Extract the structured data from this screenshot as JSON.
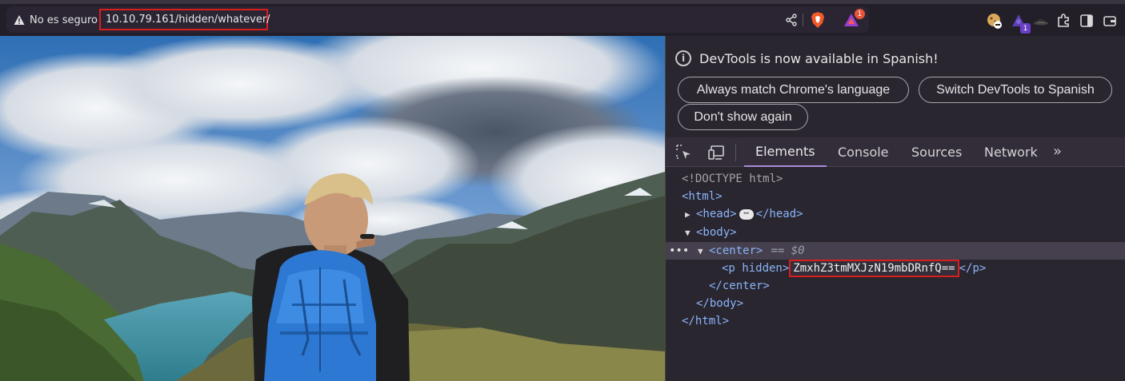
{
  "browser": {
    "security_label": "No es seguro",
    "url": "10.10.79.161/hidden/whatever/",
    "bat_badge": "1",
    "extension_badge": "1"
  },
  "devtools": {
    "info_message": "DevTools is now available in Spanish!",
    "buttons": {
      "always_match": "Always match Chrome's language",
      "switch_spanish": "Switch DevTools to Spanish",
      "dont_show": "Don't show again"
    },
    "tabs": [
      "Elements",
      "Console",
      "Sources",
      "Network"
    ],
    "dom": {
      "doctype": "<!DOCTYPE html>",
      "html_open": "<html>",
      "head_open": "<head>",
      "head_close": "</head>",
      "body_open": "<body>",
      "center_open": "<center>",
      "center_note": "== $0",
      "p_open": "<p hidden>",
      "p_text": "ZmxhZ3tmMXJzN19mbDRnfQ==",
      "p_close": "</p>",
      "center_close": "</center>",
      "body_close": "</body>",
      "html_close": "</html>"
    }
  },
  "colors": {
    "highlight_red": "#d91e1e",
    "tag_blue": "#8ab4f8",
    "active_tab_underline": "#a98bd8"
  }
}
